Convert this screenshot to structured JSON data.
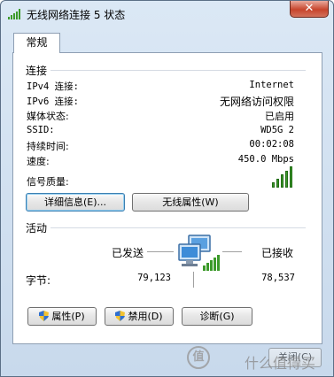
{
  "window": {
    "title": "无线网络连接 5 状态",
    "close_glyph": "✕"
  },
  "tabs": [
    {
      "label": "常规"
    }
  ],
  "connection": {
    "section_title": "连接",
    "rows": [
      {
        "label": "IPv4 连接:",
        "value": "Internet"
      },
      {
        "label": "IPv6 连接:",
        "value": "无网络访问权限"
      },
      {
        "label": "媒体状态:",
        "value": "已启用"
      },
      {
        "label": "SSID:",
        "value": "WD5G 2"
      },
      {
        "label": "持续时间:",
        "value": "00:02:08"
      },
      {
        "label": "速度:",
        "value": "450.0 Mbps"
      }
    ],
    "signal_label": "信号质量:",
    "signal_level": 5,
    "signal_max": 5,
    "details_button": "详细信息(E)...",
    "wireless_props_button": "无线属性(W)"
  },
  "activity": {
    "section_title": "活动",
    "sent_label": "已发送",
    "received_label": "已接收",
    "bytes_label": "字节:",
    "bytes_sent": "79,123",
    "bytes_received": "78,537"
  },
  "buttons": {
    "properties": "属性(P)",
    "disable": "禁用(D)",
    "diagnose": "诊断(G)",
    "close": "关闭(C)"
  },
  "watermark": {
    "text": "什么值得买",
    "logo": "值"
  },
  "colors": {
    "signal": "#3c9a2a",
    "window_bg": "#c8d9ec"
  }
}
